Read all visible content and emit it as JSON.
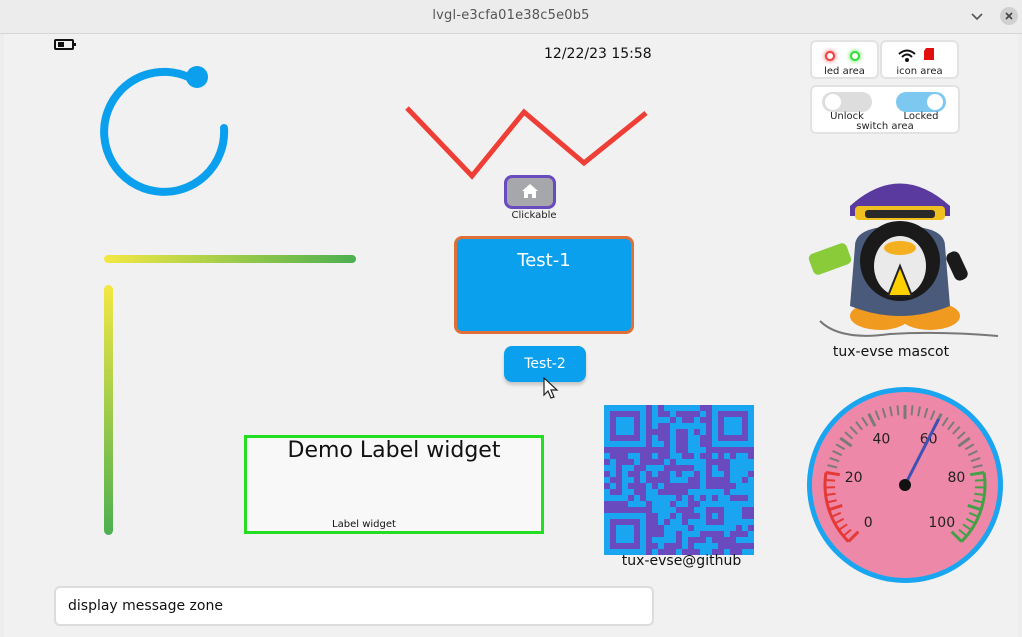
{
  "window": {
    "title": "lvgl-e3cfa01e38c5e0b5"
  },
  "header": {
    "datetime": "12/22/23 15:58"
  },
  "status": {
    "led_area_label": "led area",
    "icon_area_label": "icon area",
    "switch_area_label": "switch area",
    "switches": [
      {
        "label": "Unlock",
        "on": false
      },
      {
        "label": "Locked",
        "on": true
      }
    ],
    "leds": [
      {
        "name": "red-led",
        "color": "#f04040"
      },
      {
        "name": "green-led",
        "color": "#33dd33"
      }
    ]
  },
  "widgets": {
    "clickable_label": "Clickable",
    "test1_label": "Test-1",
    "test2_label": "Test-2",
    "demo_title": "Demo Label widget",
    "demo_caption": "Label widget",
    "qr_label": "tux-evse@github",
    "mascot_label": "tux-evse mascot"
  },
  "gauge": {
    "ticks": [
      "0",
      "20",
      "40",
      "60",
      "80",
      "100"
    ],
    "value": 60,
    "face_color": "#ee88a8",
    "ring_color": "#19a5ef"
  },
  "arc": {
    "value": 80,
    "color": "#0aa0ee"
  },
  "footer": {
    "message": "display message zone"
  },
  "colors": {
    "accent": "#0aa0ee",
    "red_line": "#ef3e36",
    "bar_start": "#f3e844",
    "bar_end": "#4caf50"
  }
}
